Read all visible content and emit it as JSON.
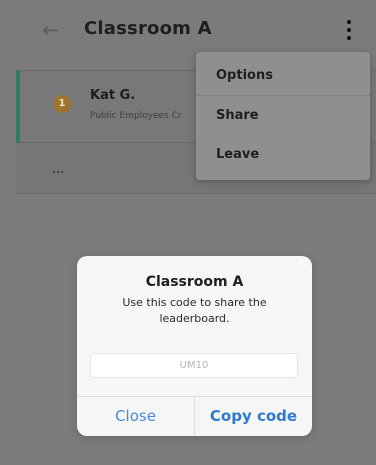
{
  "header": {
    "title": "Classroom A",
    "back_icon": "←",
    "more_icon": "vertical-ellipsis"
  },
  "list": {
    "rows": [
      {
        "rank": "1",
        "name": "Kat G.",
        "subtitle": "Public Employees Cr"
      },
      {
        "text": "..."
      }
    ]
  },
  "menu": {
    "items": [
      "Options",
      "Share",
      "Leave"
    ]
  },
  "dialog": {
    "title": "Classroom A",
    "message": "Use this code to share the leaderboard.",
    "code": "UM10",
    "close_label": "Close",
    "copy_label": "Copy code"
  },
  "colors": {
    "accent_green": "#2f7a61",
    "link_blue": "#2f79d1",
    "rank_gold": "#9c7431"
  }
}
